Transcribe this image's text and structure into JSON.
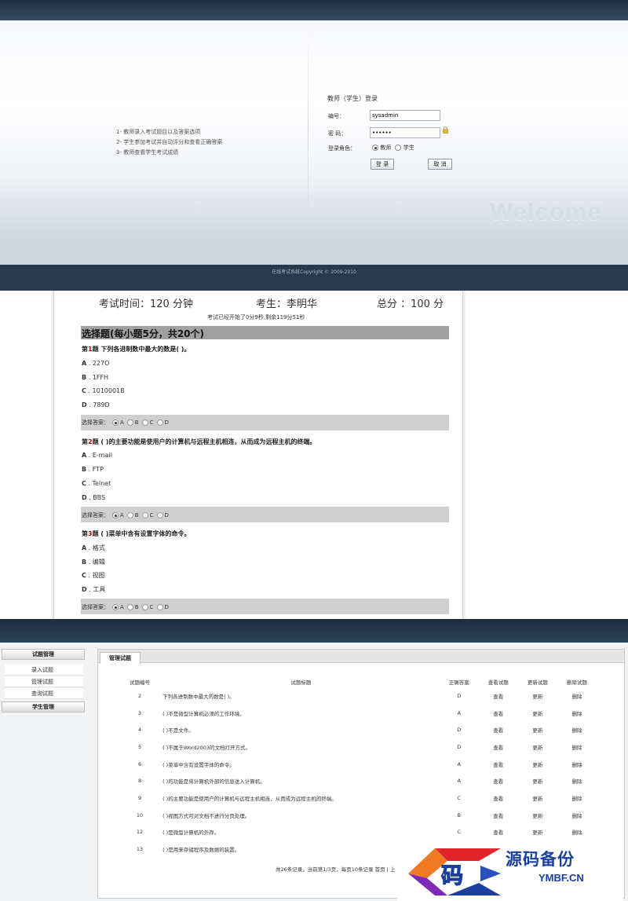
{
  "login": {
    "intro": [
      "1- 教师录入考试题目以及答案选项",
      "2- 学生参加考试并自动评分和查看正确答案",
      "3- 教师查看学生考试成绩"
    ],
    "form_title": "教师（学生）登录",
    "username_label": "编号：",
    "username_value": "sysadmin",
    "password_label": "密 码：",
    "password_value": "••••••",
    "role_label": "登录角色：",
    "role_options": [
      "教师",
      "学生"
    ],
    "role_selected": "教师",
    "login_button": "登 录",
    "cancel_button": "取 消",
    "welcome": "Welcome",
    "copyright": "在线考试系统Copyright © 2009-2010"
  },
  "exam": {
    "time_label": "考试时间：120 分钟",
    "student_label": "考生：李明华",
    "total_label": "总分 ：100 分",
    "timer_text": "考试已经开始了0分9秒,剩余119分51秒",
    "section_title": "选择题(每小题5分，共20个)",
    "answer_label": "选择答案：",
    "choices": [
      "A",
      "B",
      "C",
      "D"
    ],
    "questions": [
      {
        "prefix": "第",
        "num": "1",
        "suffix": "题 下列各进制数中最大的数是( )。",
        "options": [
          {
            "letter": "A",
            "text": "227O"
          },
          {
            "letter": "B",
            "text": "1FFH"
          },
          {
            "letter": "C",
            "text": "1010001B"
          },
          {
            "letter": "D",
            "text": "789D"
          }
        ],
        "selected": "A"
      },
      {
        "prefix": "第",
        "num": "2",
        "suffix": "题 ( )的主要功能是使用户的计算机与远程主机相连，从而成为远程主机的终端。",
        "options": [
          {
            "letter": "A",
            "text": "E-mail"
          },
          {
            "letter": "B",
            "text": "FTP"
          },
          {
            "letter": "C",
            "text": "Telnet"
          },
          {
            "letter": "D",
            "text": "BBS"
          }
        ],
        "selected": "A"
      },
      {
        "prefix": "第",
        "num": "3",
        "suffix": "题 ( )菜单中含有设置字体的命令。",
        "options": [
          {
            "letter": "A",
            "text": "格式"
          },
          {
            "letter": "B",
            "text": "编辑"
          },
          {
            "letter": "C",
            "text": "视图"
          },
          {
            "letter": "D",
            "text": "工具"
          }
        ],
        "selected": "A"
      }
    ]
  },
  "admin": {
    "sidebar": {
      "group1": "试题管理",
      "items": [
        "录入试题",
        "管理试题",
        "查询试题"
      ],
      "group2": "学生管理"
    },
    "tab": "管理试题",
    "columns": [
      "试题编号",
      "试题标题",
      "正确答案",
      "查看试题",
      "更新试题",
      "删除试题"
    ],
    "rows": [
      {
        "id": "2",
        "title": "下列各进制数中最大的数是( )。",
        "answer": "D",
        "view": "查看",
        "update": "更新",
        "delete": "删除"
      },
      {
        "id": "3",
        "title": "( )不是微型计算机必须的工作环境。",
        "answer": "A",
        "view": "查看",
        "update": "更新",
        "delete": "删除"
      },
      {
        "id": "4",
        "title": "( )不是文件。",
        "answer": "D",
        "view": "查看",
        "update": "更新",
        "delete": "删除"
      },
      {
        "id": "5",
        "title": "( )不属于Word2003的文档打开方式。",
        "answer": "D",
        "view": "查看",
        "update": "更新",
        "delete": "删除"
      },
      {
        "id": "6",
        "title": "( )菜单中含有设置字体的命令。",
        "answer": "A",
        "view": "查看",
        "update": "更新",
        "delete": "删除"
      },
      {
        "id": "8",
        "title": "( )的功能是将计算机外部的信息送入计算机。",
        "answer": "A",
        "view": "查看",
        "update": "更新",
        "delete": "删除"
      },
      {
        "id": "9",
        "title": "( )的主要功能是使用户的计算机与远程主机相连，从而成为远程主机的终端。",
        "answer": "C",
        "view": "查看",
        "update": "更新",
        "delete": "删除"
      },
      {
        "id": "10",
        "title": "( )视图方式可对文档不进行分页处理。",
        "answer": "B",
        "view": "查看",
        "update": "更新",
        "delete": "删除"
      },
      {
        "id": "12",
        "title": "( )是微型计算机的外存。",
        "answer": "C",
        "view": "查看",
        "update": "更新",
        "delete": "删除"
      },
      {
        "id": "13",
        "title": "( )是用来存储程序及数据的装置。",
        "answer": "",
        "view": "",
        "update": "",
        "delete": ""
      }
    ],
    "pager": "共26条记录，当前第1/3页，每页10条记录 首页 | 上"
  },
  "logo": {
    "brand": "源码备份",
    "domain": "YMBF.CN",
    "colors": {
      "blue": "#1b3f9c",
      "red": "#e0262b",
      "purple": "#7b2bb5"
    }
  }
}
